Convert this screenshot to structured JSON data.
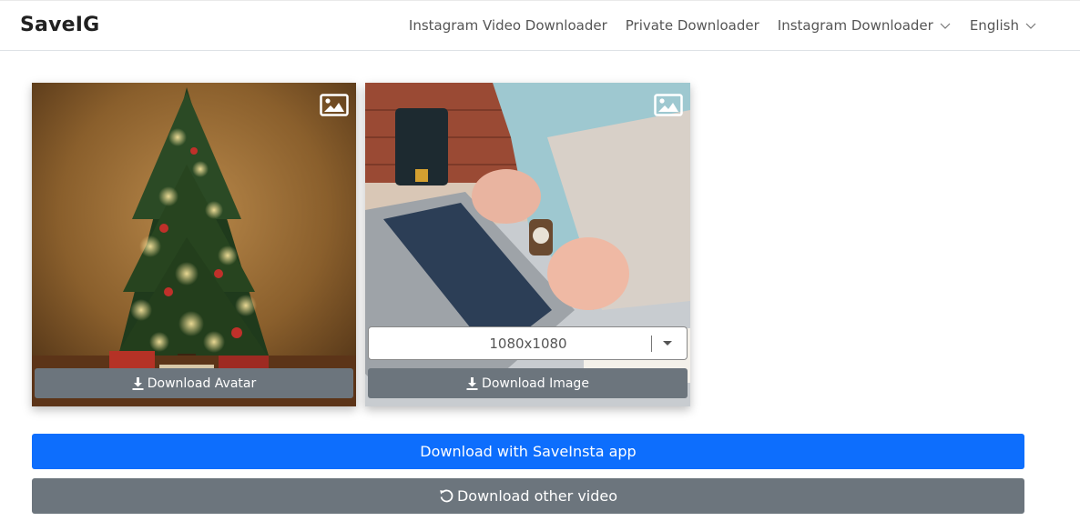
{
  "header": {
    "brand": "SaveIG",
    "nav": [
      {
        "label": "Instagram Video Downloader"
      },
      {
        "label": "Private Downloader"
      },
      {
        "label": "Instagram Downloader",
        "icon": "chevron-down-icon"
      },
      {
        "label": "English",
        "icon": "chevron-down-icon"
      }
    ]
  },
  "cards": [
    {
      "image": "christmas-tree-photo",
      "badge_icon": "image-icon",
      "download_label": "Download Avatar",
      "download_icon": "download-icon"
    },
    {
      "image": "laptop-typing-photo",
      "badge_icon": "image-icon",
      "resolution": "1080x1080",
      "download_label": "Download Image",
      "download_icon": "download-icon"
    }
  ],
  "actions": {
    "app_label": "Download with SaveInsta app",
    "other_label": "Download other video",
    "other_icon": "refresh-icon"
  },
  "colors": {
    "primary": "#0d6efd",
    "secondary": "#6c757d"
  }
}
